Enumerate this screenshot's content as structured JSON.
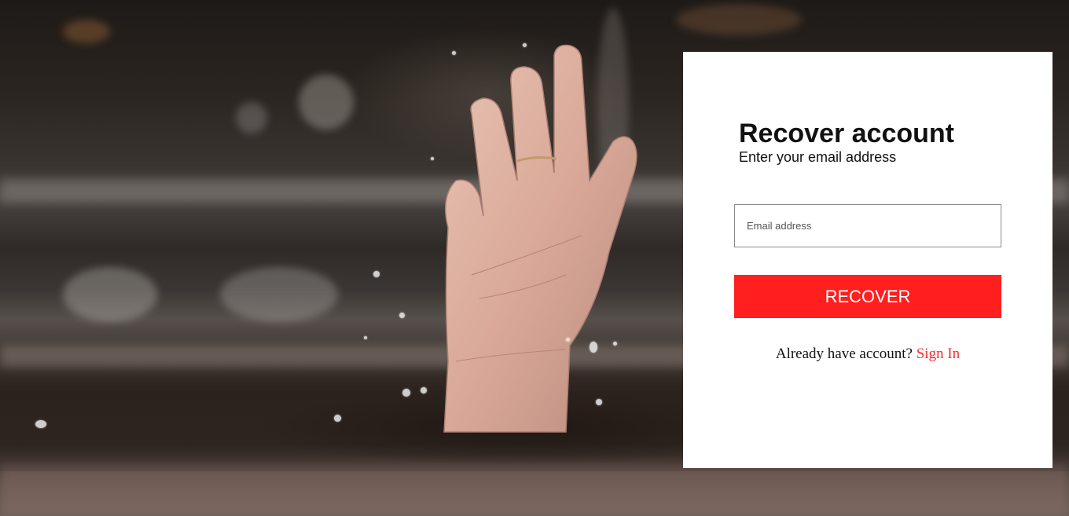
{
  "recover_card": {
    "title": "Recover account",
    "subtitle": "Enter your email address",
    "email_input": {
      "value": "",
      "placeholder": "Email address"
    },
    "recover_button_label": "RECOVER",
    "signin_prompt": "Already have account?",
    "signin_link_label": "Sign In"
  },
  "colors": {
    "accent": "#ff1f1f",
    "card_background": "#ffffff",
    "text": "#111111"
  },
  "background": {
    "icon": "hand-reaching-out-of-water-photo"
  }
}
